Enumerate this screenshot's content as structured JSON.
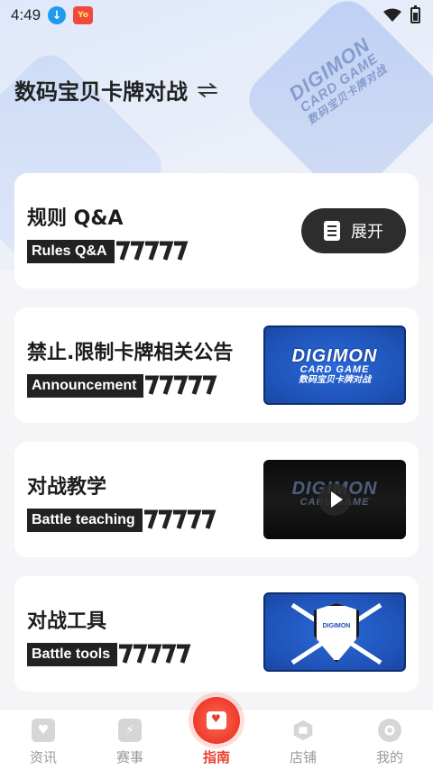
{
  "status_bar": {
    "time": "4:49"
  },
  "header": {
    "title": "数码宝贝卡牌对战",
    "switch_icon": "swap-icon"
  },
  "hero_logo": {
    "line1": "DIGIMON",
    "line2": "CARD GAME",
    "line3": "数码宝贝卡牌对战"
  },
  "cards": [
    {
      "title": "规则 Q&A",
      "tag": "Rules Q&A",
      "button_label": "展开"
    },
    {
      "title": "禁止.限制卡牌相关公告",
      "tag": "Announcement",
      "thumb": {
        "l1": "DIGIMON",
        "l2": "CARD GAME",
        "l3": "数码宝贝卡牌对战"
      }
    },
    {
      "title": "对战教学",
      "tag": "Battle teaching",
      "thumb": {
        "l1": "DIGIMON",
        "l2": "CARD GAME"
      }
    },
    {
      "title": "对战工具",
      "tag": "Battle tools",
      "thumb": {
        "l1": "DIGIMON"
      }
    }
  ],
  "bottom_nav": [
    {
      "label": "资讯",
      "icon": "news-icon",
      "active": false
    },
    {
      "label": "赛事",
      "icon": "tournament-icon",
      "active": false
    },
    {
      "label": "指南",
      "icon": "guide-icon",
      "active": true
    },
    {
      "label": "店铺",
      "icon": "shop-icon",
      "active": false
    },
    {
      "label": "我的",
      "icon": "profile-icon",
      "active": false
    }
  ],
  "colors": {
    "accent": "#ee3b2b",
    "card_thumb_blue": "#1f53b8",
    "dark_button": "#2d2d2d"
  }
}
